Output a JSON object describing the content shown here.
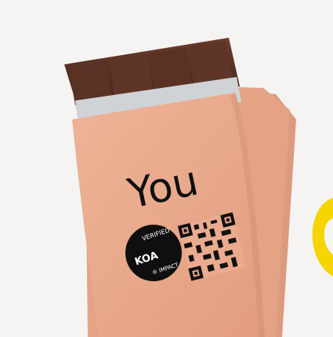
{
  "photo": {
    "wrapper_text": "You",
    "badge": {
      "arc_top": "VERIFIED",
      "arc_bottom": "® IMPACT",
      "center": "KOA"
    },
    "qr_label": "qr-code",
    "accent_shape": "yellow-c-fragment"
  },
  "colors": {
    "background": "#f4f3f2",
    "wrapper": "#e8a78a",
    "wrapper_shadow": "#cf8e72",
    "chocolate": "#4a2a1f",
    "chocolate_light": "#6a3e2e",
    "foil": "#cfd3d6",
    "badge": "#0f0f0f",
    "accent": "#f5d400"
  }
}
